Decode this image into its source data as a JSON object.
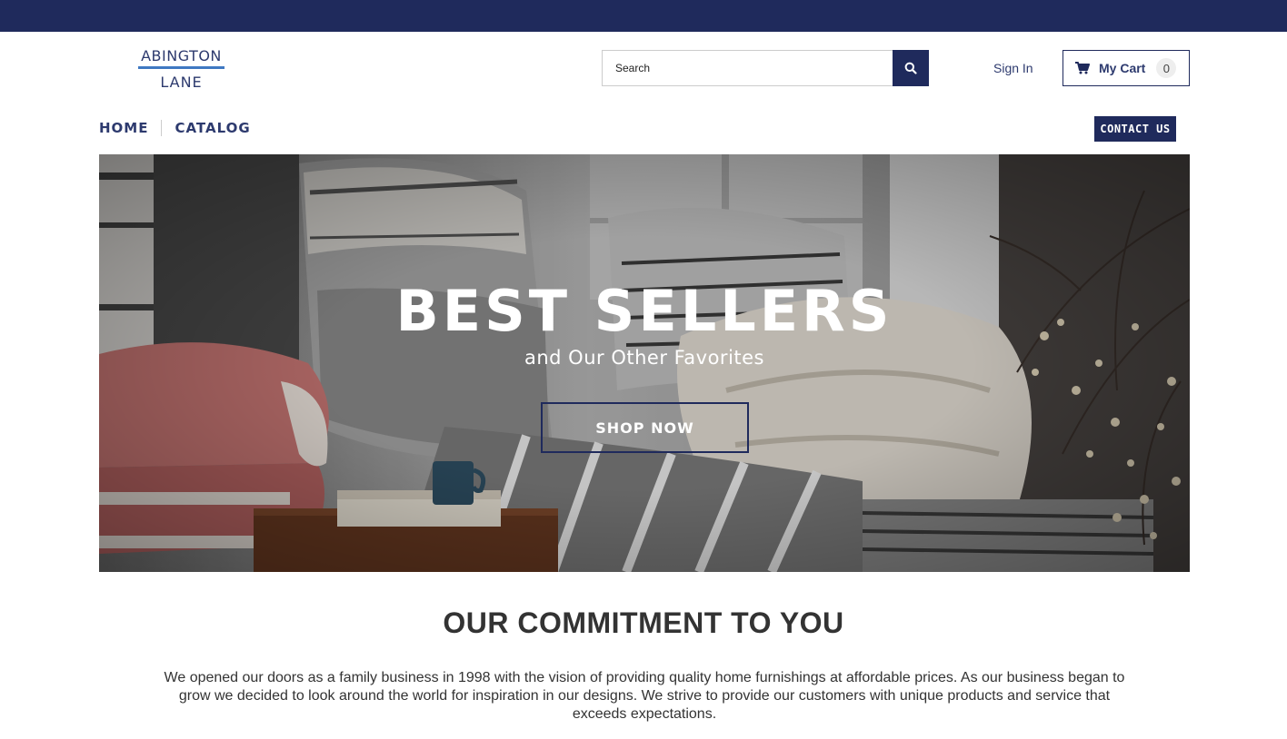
{
  "brand": {
    "line1": "ABINGTON",
    "line2": "LANE",
    "accent_color": "#1f2a5c",
    "rule_color": "#3f78c2"
  },
  "header": {
    "search": {
      "placeholder": "Search",
      "icon": "search-icon"
    },
    "sign_in": "Sign In",
    "cart": {
      "label": "My Cart",
      "count": "0",
      "icon": "cart-icon"
    }
  },
  "nav": {
    "items": [
      {
        "label": "HOME"
      },
      {
        "label": "CATALOG"
      }
    ],
    "contact": "CONTACT US"
  },
  "hero": {
    "title": "BEST SELLERS",
    "subtitle": "and Our Other Favorites",
    "cta": "SHOP NOW"
  },
  "commitment": {
    "title": "OUR COMMITMENT TO YOU",
    "text": "We opened our doors as a family business in 1998 with the vision of providing quality home furnishings at affordable prices. As our business began to grow we decided to look around the world for inspiration in our designs. We strive to provide our customers with unique products and service that exceeds expectations."
  }
}
